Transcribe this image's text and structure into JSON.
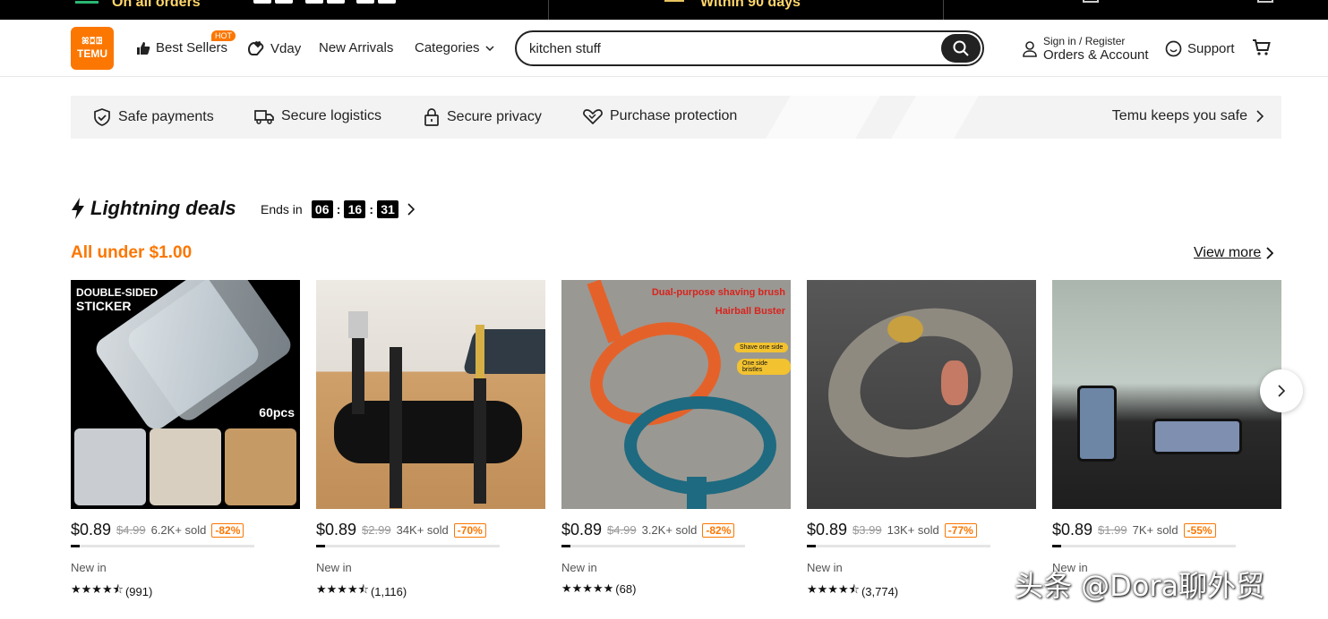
{
  "promo": {
    "left_text": "On all orders",
    "middle_text": "Within 90 days"
  },
  "brand": {
    "logo_glyphs": "ꕤꗞꖸ",
    "logo_text": "TEMU",
    "accent": "#fb7701"
  },
  "nav": {
    "best_sellers": "Best Sellers",
    "hot_badge": "HOT",
    "vday": "Vday",
    "new_arrivals": "New Arrivals",
    "categories": "Categories"
  },
  "search": {
    "value": "kitchen stuff"
  },
  "account": {
    "line1": "Sign in / Register",
    "line2": "Orders & Account"
  },
  "support": "Support",
  "safety": {
    "items": [
      "Safe payments",
      "Secure logistics",
      "Secure privacy",
      "Purchase protection"
    ],
    "keep_safe": "Temu keeps you safe"
  },
  "deals": {
    "title": "Lightning deals",
    "ends_label": "Ends in",
    "hours": "06",
    "minutes": "16",
    "seconds": "31",
    "subtitle": "All under $1.00",
    "view_more": "View more"
  },
  "products": [
    {
      "price": "$0.89",
      "old": "$4.99",
      "sold": "6.2K+ sold",
      "discount": "-82%",
      "progress": 0.05,
      "new_in": "New in",
      "stars": "★★★★⯪",
      "reviews": "(991)",
      "img_text1": "DOUBLE-SIDED",
      "img_text2": "STICKER",
      "img_text3": "60pcs"
    },
    {
      "price": "$0.89",
      "old": "$2.99",
      "sold": "34K+ sold",
      "discount": "-70%",
      "progress": 0.05,
      "new_in": "New in",
      "stars": "★★★★⯪",
      "reviews": "(1,116)"
    },
    {
      "price": "$0.89",
      "old": "$4.99",
      "sold": "3.2K+ sold",
      "discount": "-82%",
      "progress": 0.05,
      "new_in": "New in",
      "stars": "★★★★★",
      "reviews": "(68)",
      "img_text1": "Dual-purpose shaving brush",
      "img_text2": "Hairball Buster",
      "img_text3": "Shave one side",
      "img_text4": "One side bristles"
    },
    {
      "price": "$0.89",
      "old": "$3.99",
      "sold": "13K+ sold",
      "discount": "-77%",
      "progress": 0.05,
      "new_in": "New in",
      "stars": "★★★★⯪",
      "reviews": "(3,774)"
    },
    {
      "price": "$0.89",
      "old": "$1.99",
      "sold": "7K+ sold",
      "discount": "-55%",
      "progress": 0.05,
      "new_in": "New in",
      "stars": "",
      "reviews": ""
    }
  ],
  "watermark": "头条 @Dora聊外贸"
}
